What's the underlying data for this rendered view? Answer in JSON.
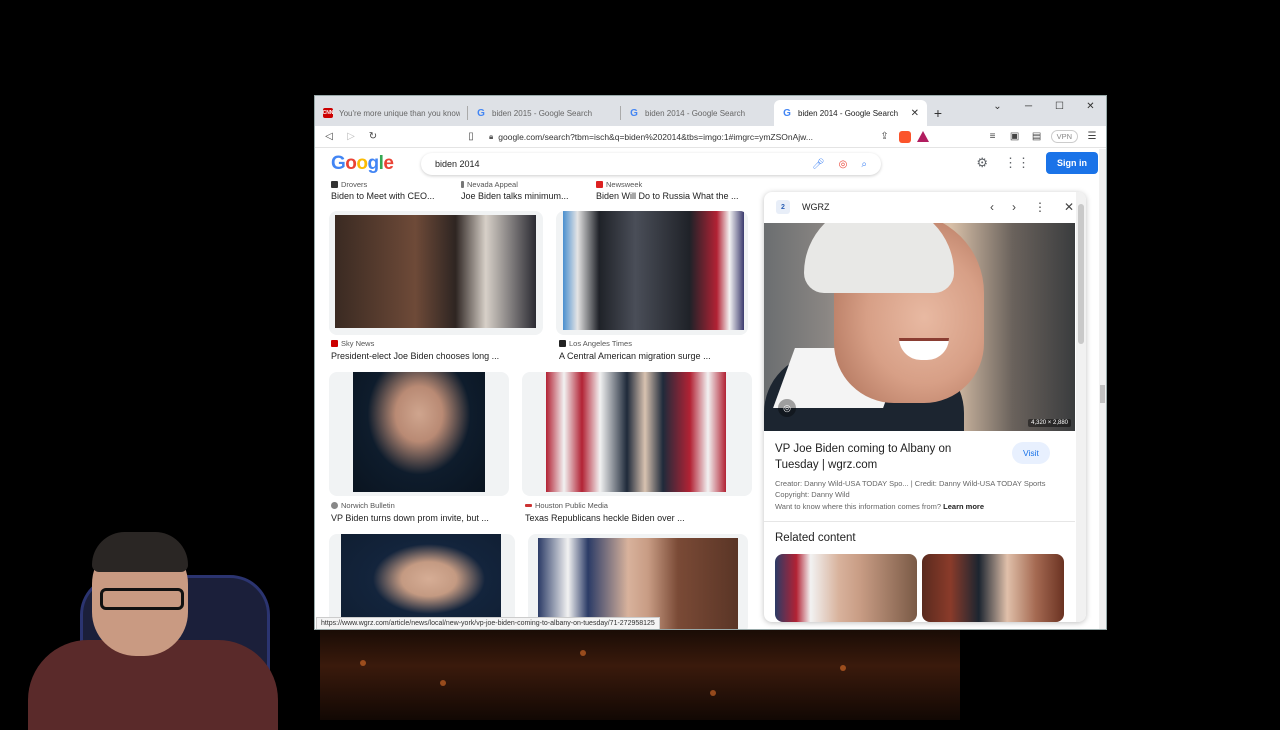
{
  "browser": {
    "tabs": [
      {
        "label": "You're more unique than you know |",
        "favicon": "cnn-icon",
        "active": false
      },
      {
        "label": "biden 2015 - Google Search",
        "favicon": "google-icon",
        "active": false
      },
      {
        "label": "biden 2014 - Google Search",
        "favicon": "google-icon",
        "active": false
      },
      {
        "label": "biden 2014 - Google Search",
        "favicon": "google-icon",
        "active": true
      }
    ],
    "url": "google.com/search?tbm=isch&q=biden%202014&tbs=imgo:1#imgrc=ymZSOnAjw...",
    "vpn_label": "VPN",
    "status_url": "https://www.wgrz.com/article/news/local/new-york/vp-joe-biden-coming-to-albany-on-tuesday/71-272958125"
  },
  "google": {
    "logo": [
      "G",
      "o",
      "o",
      "g",
      "l",
      "e"
    ],
    "query": "biden 2014",
    "signin_label": "Sign in"
  },
  "results": {
    "row0": [
      {
        "source": "Drovers",
        "caption": "Biden to Meet with CEO..."
      },
      {
        "source": "Nevada Appeal",
        "caption": "Joe Biden talks minimum..."
      },
      {
        "source": "Newsweek",
        "caption": "Biden Will Do to Russia What the ..."
      }
    ],
    "row1": [
      {
        "source": "Sky News",
        "caption": "President-elect Joe Biden chooses long ..."
      },
      {
        "source": "Los Angeles Times",
        "caption": "A Central American migration surge ..."
      }
    ],
    "row2": [
      {
        "source": "Norwich Bulletin",
        "caption": "VP Biden turns down prom invite, but ..."
      },
      {
        "source": "Houston Public Media",
        "caption": "Texas Republicans heckle Biden over ..."
      }
    ]
  },
  "panel": {
    "site": "WGRZ",
    "site_badge": "2",
    "image_dims": "4,320 × 2,880",
    "title": "VP Joe Biden coming to Albany on Tuesday | wgrz.com",
    "visit_label": "Visit",
    "meta": "Creator: Danny Wild-USA TODAY Spo... | Credit: Danny Wild-USA TODAY Sports",
    "copyright": "Copyright: Danny Wild",
    "want_prefix": "Want to know where this information comes from?",
    "learn_more": "Learn more",
    "related_heading": "Related content"
  }
}
